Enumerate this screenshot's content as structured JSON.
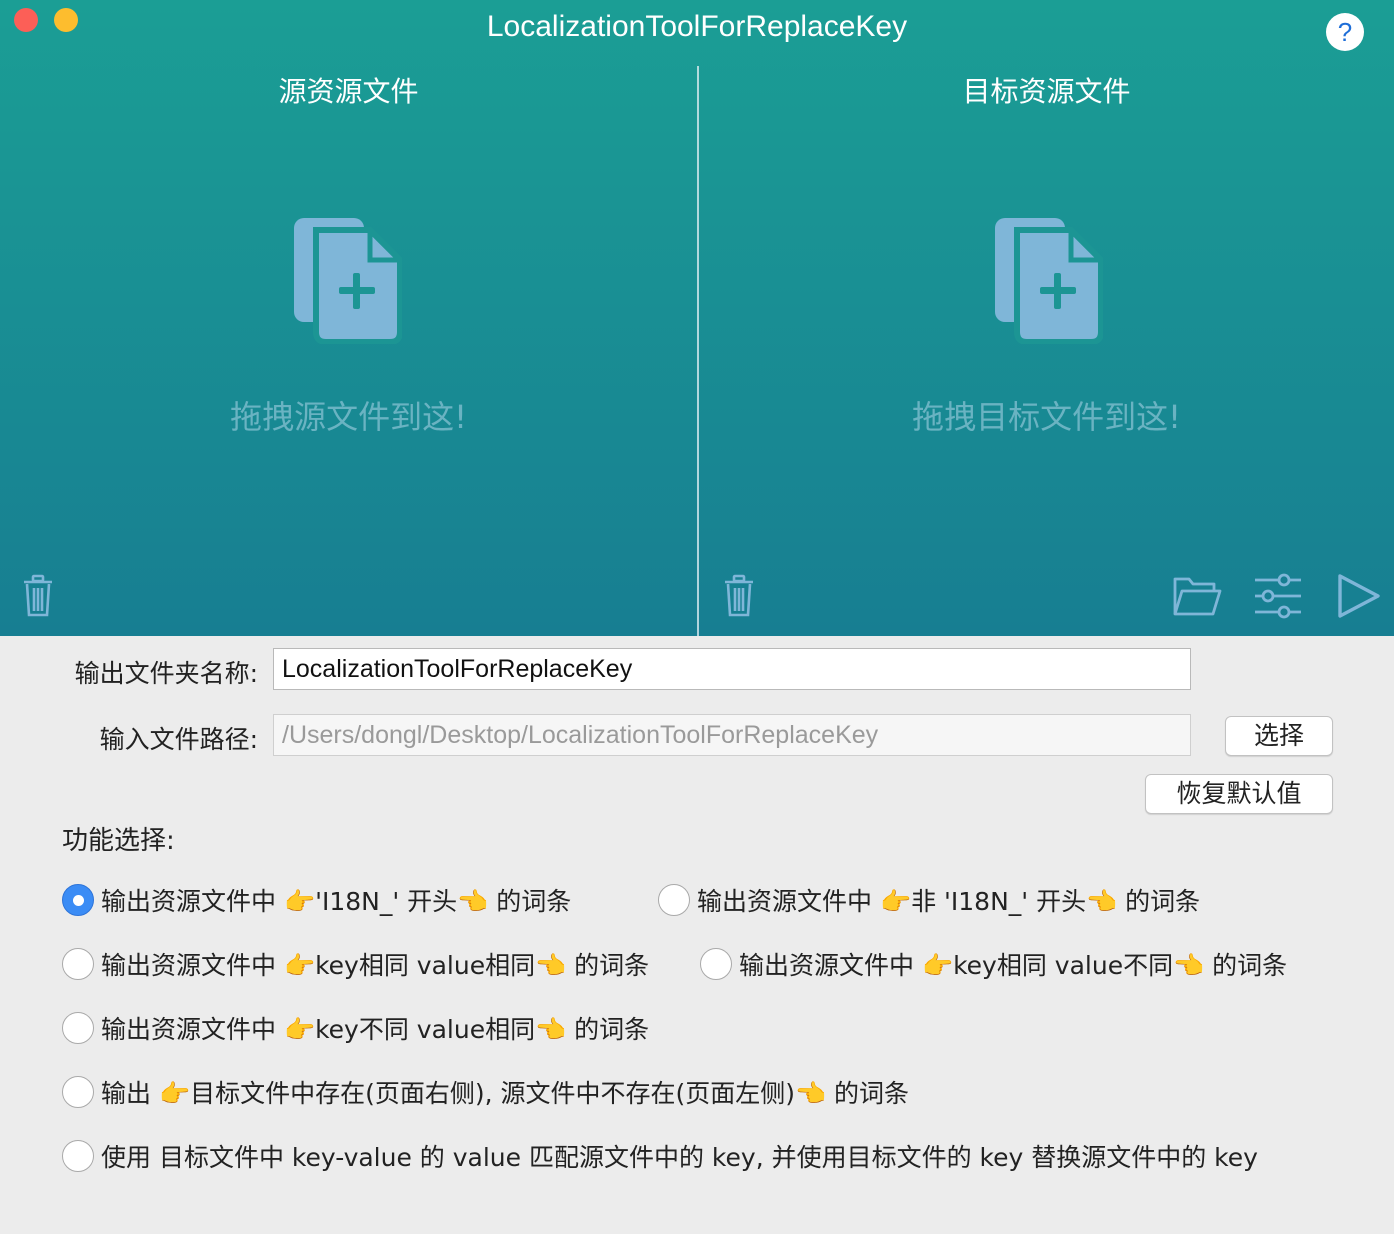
{
  "window": {
    "title": "LocalizationToolForReplaceKey",
    "help_label": "?"
  },
  "source_panel": {
    "title": "源资源文件",
    "drop_hint": "拖拽源文件到这!"
  },
  "target_panel": {
    "title": "目标资源文件",
    "drop_hint": "拖拽目标文件到这!"
  },
  "colors": {
    "header_top": "#1b9e95",
    "header_bottom": "#177e92",
    "accent": "#3b8cf5",
    "icon": "#7fb6d8"
  },
  "form": {
    "output_folder_label": "输出文件夹名称:",
    "output_folder_value": "LocalizationToolForReplaceKey",
    "input_path_label": "输入文件路径:",
    "input_path_value": "/Users/dongl/Desktop/LocalizationToolForReplaceKey",
    "choose_button": "选择",
    "reset_button": "恢复默认值"
  },
  "functions": {
    "label": "功能选择:",
    "options": [
      {
        "label": "输出资源文件中 👉'I18N_' 开头👈 的词条",
        "selected": true
      },
      {
        "label": "输出资源文件中 👉非 'I18N_' 开头👈 的词条",
        "selected": false
      },
      {
        "label": "输出资源文件中 👉key相同  value相同👈 的词条",
        "selected": false
      },
      {
        "label": "输出资源文件中 👉key相同  value不同👈 的词条",
        "selected": false
      },
      {
        "label": "输出资源文件中 👉key不同  value相同👈 的词条",
        "selected": false
      },
      {
        "label": "输出 👉目标文件中存在(页面右侧), 源文件中不存在(页面左侧)👈 的词条",
        "selected": false
      },
      {
        "label": "使用 目标文件中 key-value 的 value 匹配源文件中的 key, 并使用目标文件的 key 替换源文件中的 key",
        "selected": false
      }
    ]
  },
  "icons": {
    "source_drop": "add-file-icon",
    "target_drop": "add-file-icon",
    "source_trash": "trash-icon",
    "target_trash": "trash-icon",
    "folder": "folder-icon",
    "settings": "sliders-icon",
    "run": "play-icon"
  }
}
